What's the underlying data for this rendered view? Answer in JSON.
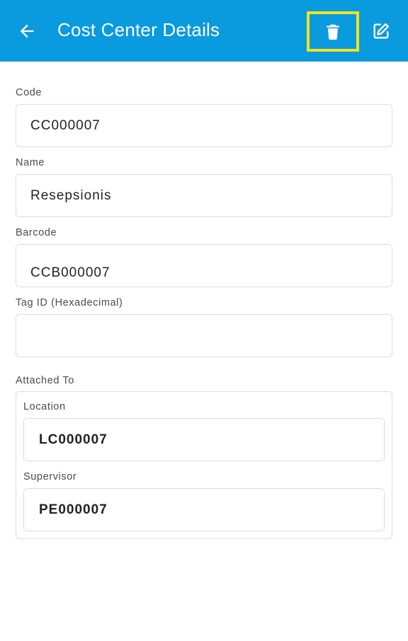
{
  "appbar": {
    "title": "Cost Center Details",
    "back_icon": "arrow-left-icon",
    "delete_icon": "trash-icon",
    "edit_icon": "edit-icon",
    "background_color": "#0a9ade",
    "highlight_color": "#f5e31b"
  },
  "fields": {
    "code": {
      "label": "Code",
      "value": "CC000007"
    },
    "name": {
      "label": "Name",
      "value": "Resepsionis"
    },
    "barcode": {
      "label": "Barcode",
      "value": "CCB000007"
    },
    "tag_id": {
      "label": "Tag ID (Hexadecimal)",
      "value": ""
    }
  },
  "attached_to": {
    "label": "Attached To",
    "location": {
      "label": "Location",
      "value": "LC000007"
    },
    "supervisor": {
      "label": "Supervisor",
      "value": "PE000007"
    }
  }
}
